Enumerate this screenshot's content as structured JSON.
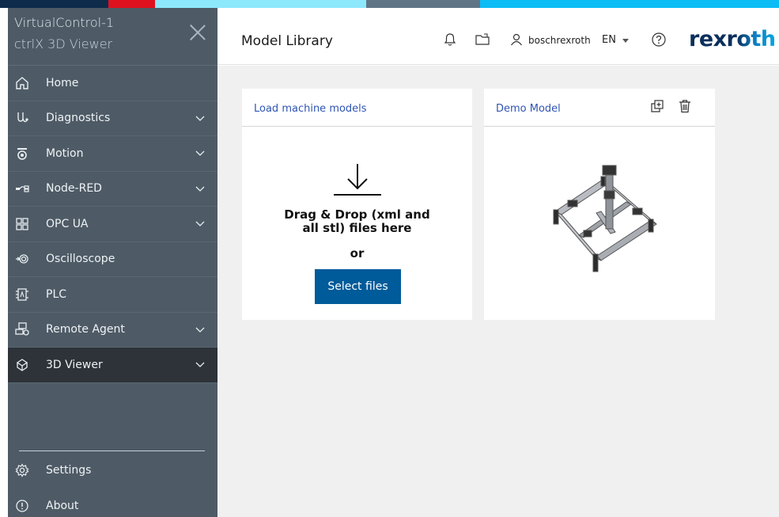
{
  "top_strip": [
    {
      "color": "#0e2b4c",
      "width": 137
    },
    {
      "color": "#e0111f",
      "width": 59
    },
    {
      "color": "#8de8fb",
      "width": 267
    },
    {
      "color": "#5f7686",
      "width": 144
    },
    {
      "color": "#0bbcf5",
      "width": 378
    }
  ],
  "sidebar": {
    "app_name": "VirtualControl-1",
    "app_sub": "ctrlX 3D Viewer",
    "items": [
      {
        "label": "Home",
        "icon": "home-icon",
        "expandable": false
      },
      {
        "label": "Diagnostics",
        "icon": "diagnostics-icon",
        "expandable": true
      },
      {
        "label": "Motion",
        "icon": "motion-icon",
        "expandable": true
      },
      {
        "label": "Node-RED",
        "icon": "node-red-icon",
        "expandable": true
      },
      {
        "label": "OPC UA",
        "icon": "opc-ua-icon",
        "expandable": true
      },
      {
        "label": "Oscilloscope",
        "icon": "oscilloscope-icon",
        "expandable": false
      },
      {
        "label": "PLC",
        "icon": "plc-icon",
        "expandable": false
      },
      {
        "label": "Remote Agent",
        "icon": "remote-agent-icon",
        "expandable": true
      },
      {
        "label": "3D Viewer",
        "icon": "3d-viewer-icon",
        "expandable": true,
        "active": true
      }
    ],
    "bottom_items": [
      {
        "label": "Settings",
        "icon": "gear-icon"
      },
      {
        "label": "About",
        "icon": "info-icon"
      }
    ]
  },
  "header": {
    "title": "Model Library",
    "username": "boschrexroth",
    "language": "EN",
    "logo": "rexroth"
  },
  "cards": {
    "load": {
      "title": "Load machine models",
      "drop_text_line1": "Drag & Drop (xml and",
      "drop_text_line2": "all stl) files here",
      "or_text": "or",
      "select_button": "Select files"
    },
    "demo": {
      "title": "Demo Model"
    }
  },
  "colors": {
    "sidebar_bg": "#4e5b66",
    "sidebar_active": "#2d3338",
    "accent_blue": "#005b9a",
    "link_blue": "#2f55b3",
    "logo_dark": "#0b2f5b",
    "logo_accent": "#00a8e1"
  }
}
